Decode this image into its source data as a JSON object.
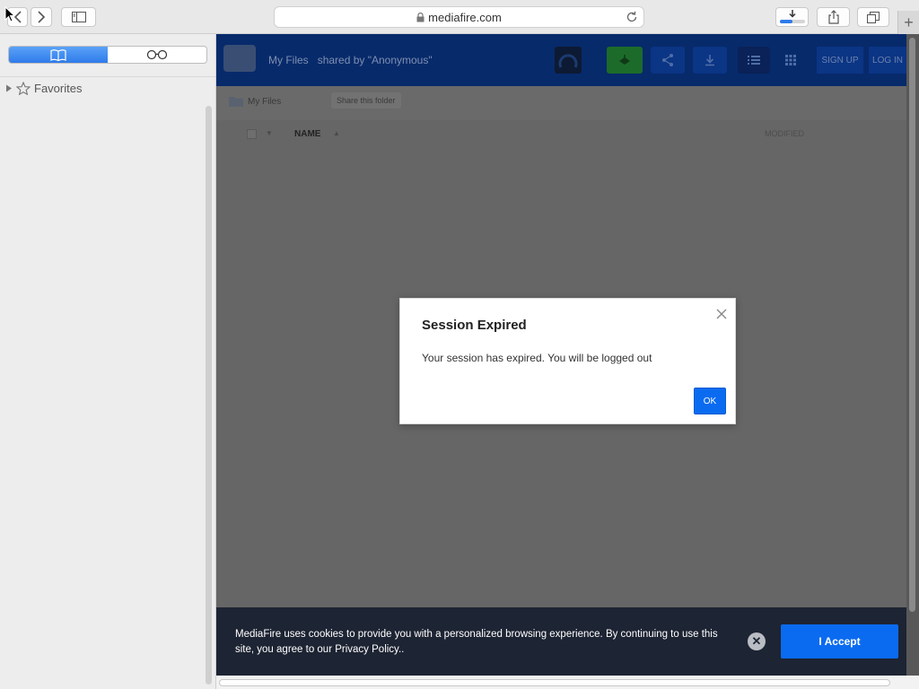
{
  "browser": {
    "url": "mediafire.com"
  },
  "sidebar": {
    "favorites_label": "Favorites"
  },
  "header": {
    "title": "My Files",
    "shared_by": "shared by \"Anonymous\"",
    "signup_label": "SIGN UP",
    "login_label": "LOG IN"
  },
  "crumbbar": {
    "crumb": "My Files",
    "share_label": "Share this folder"
  },
  "columns": {
    "name": "NAME",
    "modified": "MODIFIED"
  },
  "modal": {
    "title": "Session Expired",
    "message": "Your session has expired. You will be logged out",
    "ok_label": "OK"
  },
  "cookie": {
    "text": "MediaFire uses cookies to provide you with a personalized browsing experience. By continuing to use this site, you agree to our Privacy Policy..",
    "accept_label": "I Accept"
  },
  "colors": {
    "accent": "#0b6bf0",
    "header_bg": "#072a6b",
    "cookie_bg": "#1d2433"
  },
  "icons": {
    "back": "chevron-left-icon",
    "forward": "chevron-right-icon",
    "sidebar_toggle": "sidebar-icon",
    "lock": "lock-icon",
    "reload": "reload-icon",
    "downloads": "download-icon",
    "share": "share-icon",
    "tabs": "tabs-icon",
    "new_tab": "plus-icon",
    "bookmarks": "book-icon",
    "reading_list": "glasses-icon",
    "favorites": "star-icon"
  }
}
